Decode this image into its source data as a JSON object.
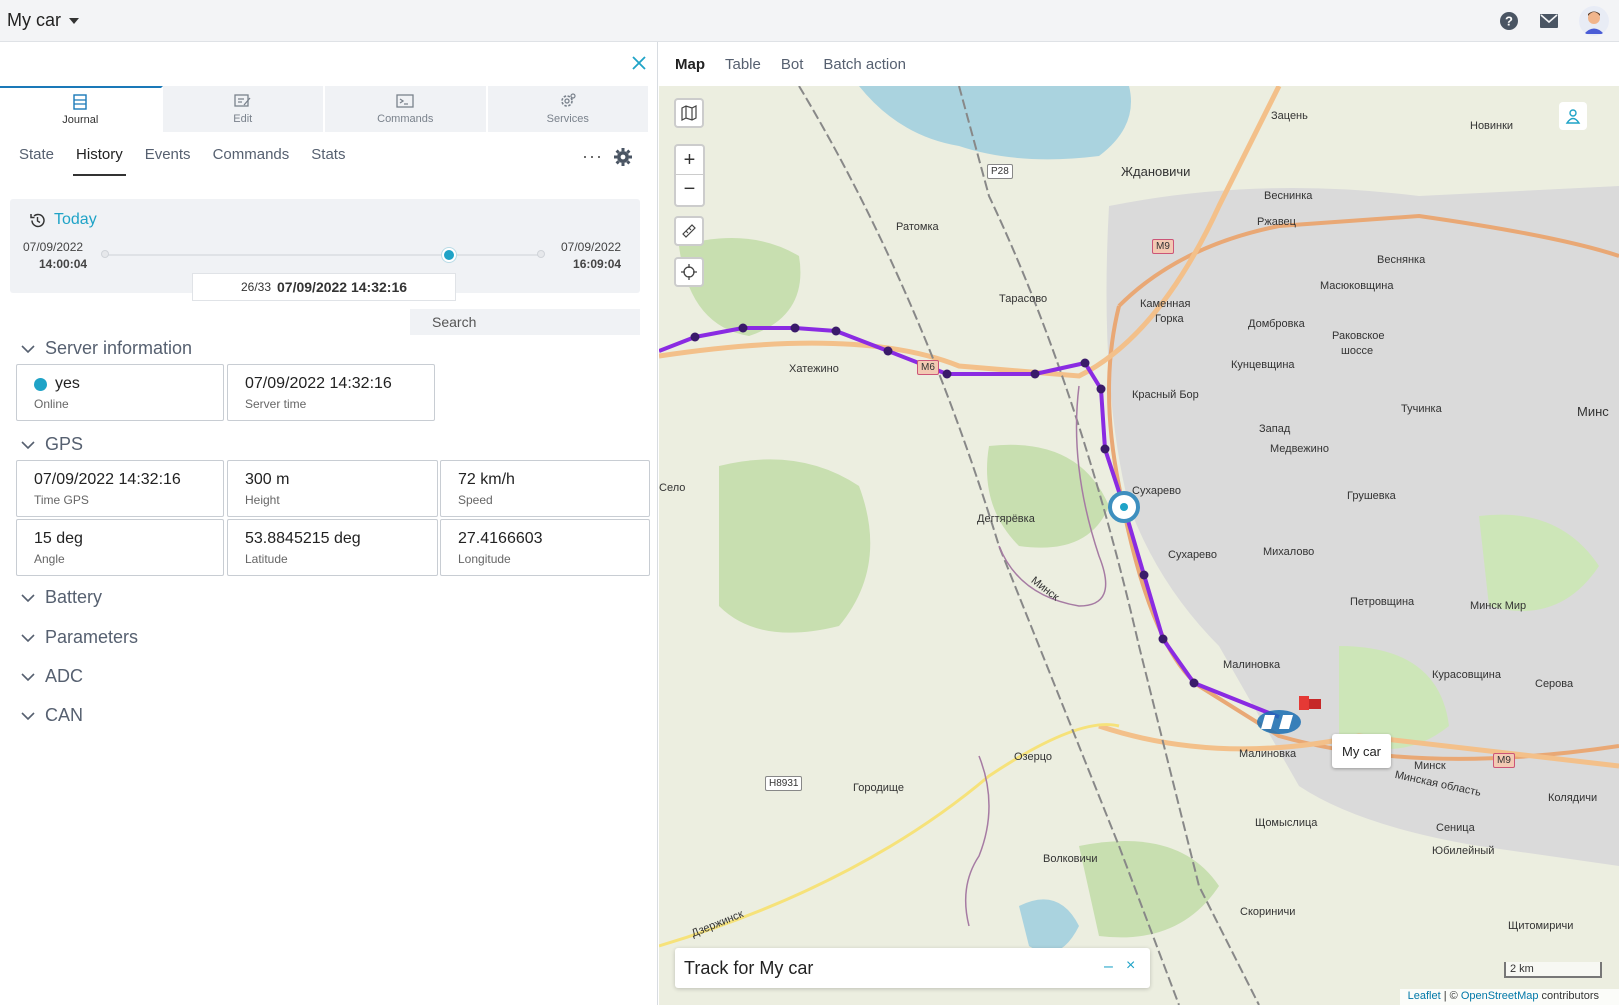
{
  "header": {
    "title": "My car"
  },
  "left_tabs": [
    {
      "label": "Journal"
    },
    {
      "label": "Edit"
    },
    {
      "label": "Commands"
    },
    {
      "label": "Services"
    }
  ],
  "sub_tabs": [
    {
      "label": "State"
    },
    {
      "label": "History"
    },
    {
      "label": "Events"
    },
    {
      "label": "Commands"
    },
    {
      "label": "Stats"
    }
  ],
  "history": {
    "period_label": "Today",
    "start_date": "07/09/2022",
    "start_time": "14:00:04",
    "end_date": "07/09/2022",
    "end_time": "16:09:04",
    "position": "26/33",
    "current_datetime": "07/09/2022 14:32:16",
    "progress_fraction": 0.79
  },
  "search": {
    "placeholder": "Search"
  },
  "sections": {
    "server": "Server information",
    "gps": "GPS",
    "battery": "Battery",
    "parameters": "Parameters",
    "adc": "ADC",
    "can": "CAN"
  },
  "server_info": {
    "online_value": "yes",
    "online_label": "Online",
    "server_time_value": "07/09/2022 14:32:16",
    "server_time_label": "Server time"
  },
  "gps": {
    "time_value": "07/09/2022 14:32:16",
    "time_label": "Time GPS",
    "height_value": "300 m",
    "height_label": "Height",
    "speed_value": "72 km/h",
    "speed_label": "Speed",
    "angle_value": "15 deg",
    "angle_label": "Angle",
    "lat_value": "53.8845215 deg",
    "lat_label": "Latitude",
    "lon_value": "27.4166603",
    "lon_label": "Longitude"
  },
  "view_tabs": [
    {
      "label": "Map"
    },
    {
      "label": "Table"
    },
    {
      "label": "Bot"
    },
    {
      "label": "Batch action"
    }
  ],
  "map": {
    "zoom_in": "+",
    "zoom_out": "−",
    "track_title": "Track for My car",
    "track_minimize": "–",
    "track_close": "×",
    "car_label": "My car",
    "scale": "2 km",
    "attrib_leaflet": "Leaflet",
    "attrib_sep": " | © ",
    "attrib_osm": "OpenStreetMap",
    "attrib_tail": " contributors",
    "labels": {
      "zdanovichi": "Ждановичи",
      "zacen": "Зацень",
      "novinki": "Новинки",
      "vesninka": "Веснинка",
      "rzhavets": "Ржавец",
      "vesnyanka": "Веснянка",
      "ratomka": "Ратомка",
      "tarasovo": "Тарасово",
      "kamennaya": "Каменная",
      "gorka": "Горка",
      "dombrovka": "Домбровка",
      "masyukovshchina": "Масюковщина",
      "rakovskoe": "Раковское",
      "shosse": "шоссе",
      "kuntsevshchina": "Кунцевщина",
      "khatezhino": "Хатежино",
      "krasny_bor": "Красный Бор",
      "tuchinka": "Тучинка",
      "minsk_edge": "Минс",
      "zapad": "Запад",
      "medvezhino": "Медвежино",
      "selo": "Село",
      "sukharevo1": "Сухарево",
      "grushevka": "Грушевка",
      "degtyarevka": "Дегтярёвка",
      "sukharevo2": "Сухарево",
      "mikhalovo": "Михалово",
      "minsk_road": "Минск",
      "petrovshchina": "Петровщина",
      "minsk_mir": "Минск Мир",
      "malinovka1": "Малиновка",
      "kurasovshchina": "Курасовщина",
      "serova": "Серова",
      "malinovka2": "Малиновка",
      "minsk_r": "Минск",
      "minsk_oblast": "Минская область",
      "kolyadichi": "Колядичи",
      "ozertso": "Озерцо",
      "gorodishche": "Городище",
      "shchomyslitsa": "Щомыслица",
      "senitsa": "Сеница",
      "yubileyny": "Юбилейный",
      "volkovichi": "Волковичи",
      "skorinichi": "Скориничи",
      "shchitomirichi": "Щитомиричи",
      "dzerzhinsk": "Дзержинск"
    },
    "shields": {
      "r28": "P28",
      "m9a": "M9",
      "m6": "M6",
      "h8931": "H8931",
      "m9b": "M9"
    }
  },
  "colors": {
    "accent": "#1fa3c7",
    "track": "#8a2be2",
    "tab_active": "#1a79b8"
  }
}
